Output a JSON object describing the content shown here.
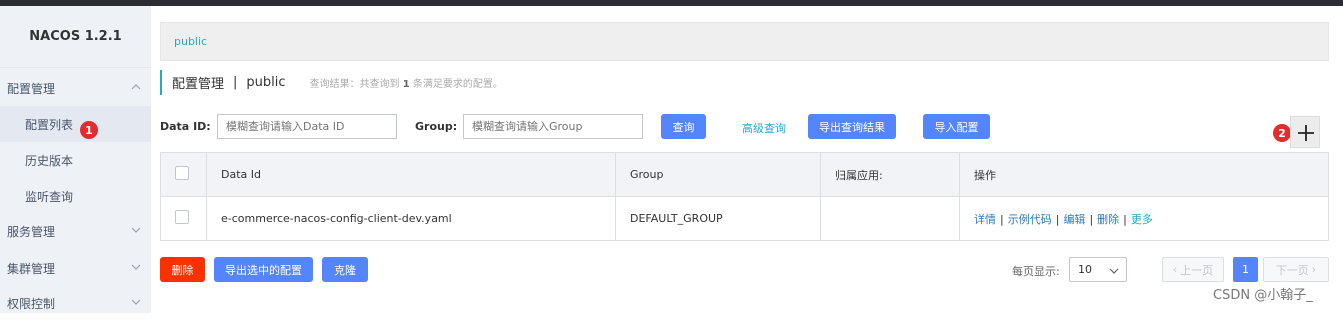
{
  "app": {
    "title": "NACOS 1.2.1"
  },
  "sidebar": {
    "groups": [
      {
        "label": "配置管理"
      },
      {
        "label": "服务管理"
      },
      {
        "label": "集群管理"
      },
      {
        "label": "权限控制"
      }
    ],
    "items": [
      {
        "label": "配置列表"
      },
      {
        "label": "历史版本"
      },
      {
        "label": "监听查询"
      }
    ],
    "badge1": "1"
  },
  "breadcrumb": {
    "namespace": "public"
  },
  "header": {
    "title": "配置管理",
    "separator": "|",
    "namespace": "public",
    "hint_prefix": "查询结果：共查询到",
    "hint_count": "1",
    "hint_suffix": "条满足要求的配置。"
  },
  "search": {
    "dataid_label": "Data ID:",
    "dataid_placeholder": "模糊查询请输入Data ID",
    "group_label": "Group:",
    "group_placeholder": "模糊查询请输入Group",
    "query_button": "查询",
    "advanced_link": "高级查询",
    "export_result_button": "导出查询结果",
    "import_button": "导入配置"
  },
  "add": {
    "badge": "2"
  },
  "table": {
    "columns": [
      "Data Id",
      "Group",
      "归属应用:",
      "操作"
    ],
    "rows": [
      {
        "data_id": "e-commerce-nacos-config-client-dev.yaml",
        "group": "DEFAULT_GROUP",
        "app": "",
        "ops": {
          "detail": "详情",
          "sample": "示例代码",
          "edit": "编辑",
          "delete": "删除",
          "more": "更多",
          "sep": "|"
        }
      }
    ]
  },
  "footer": {
    "delete_button": "删除",
    "export_selected_button": "导出选中的配置",
    "clone_button": "克隆",
    "per_page_label": "每页显示:",
    "per_page_value": "10",
    "prev": "上一页",
    "page": "1",
    "next": "下一页"
  },
  "watermark": "CSDN @小翰子_",
  "colors": {
    "accent": "#5584ff",
    "danger": "#ff3000",
    "link": "#2ba6cb",
    "badge": "#e02d2d"
  }
}
